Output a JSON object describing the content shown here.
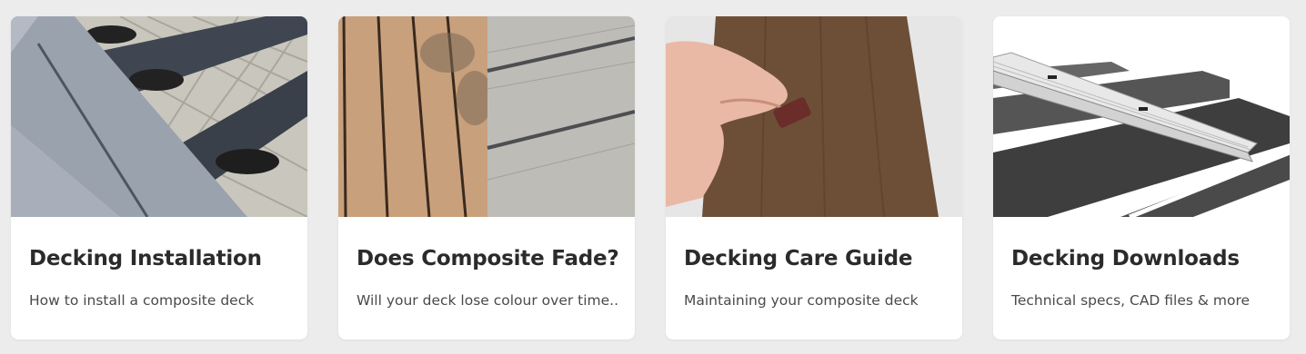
{
  "cards": [
    {
      "title": "Decking Installation",
      "subtitle": "How to install a composite deck",
      "image_icon": "deck-installation-photo"
    },
    {
      "title": "Does Composite Fade?",
      "subtitle": "Will your deck lose colour over time..",
      "image_icon": "composite-fade-comparison-photo"
    },
    {
      "title": "Decking Care Guide",
      "subtitle": "Maintaining your composite deck",
      "image_icon": "deck-cleaning-photo"
    },
    {
      "title": "Decking Downloads",
      "subtitle": "Technical specs, CAD files & more",
      "image_icon": "deck-cad-render"
    }
  ]
}
